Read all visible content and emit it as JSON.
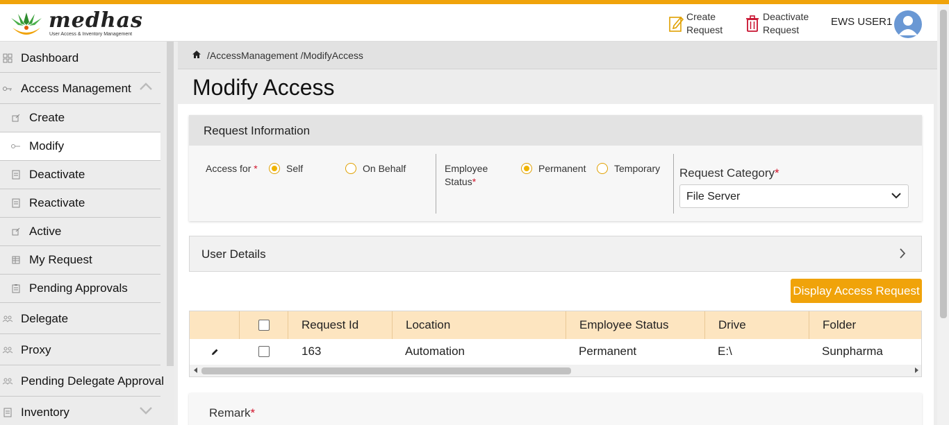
{
  "app": {
    "brand": "medhas",
    "tagline": "User Access & Inventory Management"
  },
  "header": {
    "create_request": "Create Request",
    "create_request_l1": "Create",
    "create_request_l2": "Request",
    "deactivate_request_l1": "Deactivate",
    "deactivate_request_l2": "Request",
    "user": "EWS USER1"
  },
  "sidebar": {
    "items": [
      {
        "label": "Dashboard",
        "icon": "dashboard-icon"
      },
      {
        "label": "Access Management",
        "icon": "key-icon"
      },
      {
        "label": "Create",
        "icon": "edit-icon"
      },
      {
        "label": "Modify",
        "icon": "key-icon"
      },
      {
        "label": "Deactivate",
        "icon": "document-icon"
      },
      {
        "label": "Reactivate",
        "icon": "document-icon"
      },
      {
        "label": "Active",
        "icon": "edit-icon"
      },
      {
        "label": "My Request",
        "icon": "table-icon"
      },
      {
        "label": "Pending Approvals",
        "icon": "clipboard-icon"
      },
      {
        "label": "Delegate",
        "icon": "users-icon"
      },
      {
        "label": "Proxy",
        "icon": "users-icon"
      },
      {
        "label": "Pending Delegate Approval",
        "icon": "users-icon"
      },
      {
        "label": "Inventory",
        "icon": "document-icon"
      }
    ],
    "active": "Modify"
  },
  "breadcrumb": "/AccessManagement /ModifyAccess",
  "page_title": "Modify Access",
  "request_info": {
    "title": "Request Information",
    "access_for_label": "Access for",
    "access_for_options": [
      "Self",
      "On Behalf"
    ],
    "access_for_selected": "Self",
    "employee_status_label_l1": "Employee",
    "employee_status_label_l2": "Status",
    "employee_status_options": [
      "Permanent",
      "Temporary"
    ],
    "employee_status_selected": "Permanent",
    "request_category_label": "Request Category",
    "request_category_value": "File Server",
    "required_mark": "*"
  },
  "user_details": {
    "title": "User Details"
  },
  "display_button": "Display Access Request",
  "table": {
    "columns": [
      "Request Id",
      "Location",
      "Employee Status",
      "Drive",
      "Folder"
    ],
    "rows": [
      {
        "request_id": "163",
        "location": "Automation",
        "employee_status": "Permanent",
        "drive": "E:\\",
        "folder": "Sunpharma"
      }
    ]
  },
  "remark": {
    "label": "Remark"
  },
  "colors": {
    "accent": "#f0a30a",
    "required": "#d1122a",
    "table_header": "#fde5c0"
  }
}
